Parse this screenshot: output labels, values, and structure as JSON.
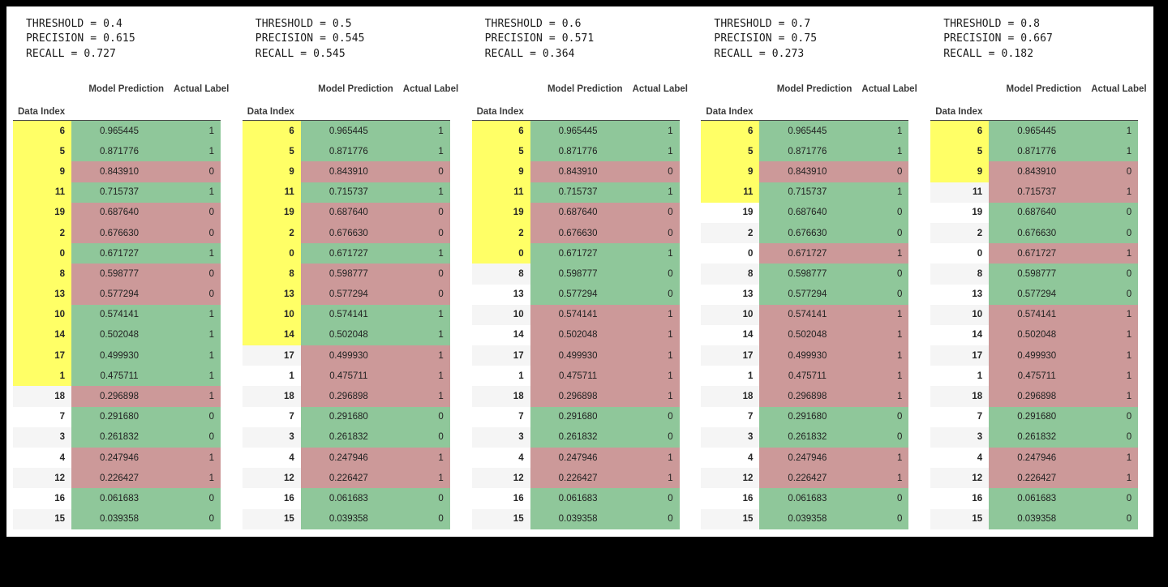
{
  "page": {
    "background_color": "#000000",
    "canvas_color": "#ffffff"
  },
  "colors": {
    "highlight_yellow": "#ffff66",
    "correct_green": "#8fc79a",
    "incorrect_red": "#cc9999",
    "row_even": "#ffffff",
    "row_odd": "#f5f5f5",
    "header_rule": "#4a4a4a",
    "text": "#222222"
  },
  "table_headers": {
    "index_name": "Data Index",
    "columns": [
      "Model Prediction",
      "Actual Label"
    ]
  },
  "rows": [
    {
      "index": "6",
      "prediction": "0.965445",
      "label": "1"
    },
    {
      "index": "5",
      "prediction": "0.871776",
      "label": "1"
    },
    {
      "index": "9",
      "prediction": "0.843910",
      "label": "0"
    },
    {
      "index": "11",
      "prediction": "0.715737",
      "label": "1"
    },
    {
      "index": "19",
      "prediction": "0.687640",
      "label": "0"
    },
    {
      "index": "2",
      "prediction": "0.676630",
      "label": "0"
    },
    {
      "index": "0",
      "prediction": "0.671727",
      "label": "1"
    },
    {
      "index": "8",
      "prediction": "0.598777",
      "label": "0"
    },
    {
      "index": "13",
      "prediction": "0.577294",
      "label": "0"
    },
    {
      "index": "10",
      "prediction": "0.574141",
      "label": "1"
    },
    {
      "index": "14",
      "prediction": "0.502048",
      "label": "1"
    },
    {
      "index": "17",
      "prediction": "0.499930",
      "label": "1"
    },
    {
      "index": "1",
      "prediction": "0.475711",
      "label": "1"
    },
    {
      "index": "18",
      "prediction": "0.296898",
      "label": "1"
    },
    {
      "index": "7",
      "prediction": "0.291680",
      "label": "0"
    },
    {
      "index": "3",
      "prediction": "0.261832",
      "label": "0"
    },
    {
      "index": "4",
      "prediction": "0.247946",
      "label": "1"
    },
    {
      "index": "12",
      "prediction": "0.226427",
      "label": "1"
    },
    {
      "index": "16",
      "prediction": "0.061683",
      "label": "0"
    },
    {
      "index": "15",
      "prediction": "0.039358",
      "label": "0"
    }
  ],
  "panels": [
    {
      "metrics": {
        "threshold_line": "THRESHOLD = 0.4",
        "precision_line": "PRECISION = 0.615",
        "recall_line": "RECALL = 0.727",
        "threshold": 0.4,
        "precision": 0.615,
        "recall": 0.727
      },
      "highlighted_count": 13,
      "has_scrollbar": false
    },
    {
      "metrics": {
        "threshold_line": "THRESHOLD = 0.5",
        "precision_line": "PRECISION = 0.545",
        "recall_line": "RECALL = 0.545",
        "threshold": 0.5,
        "precision": 0.545,
        "recall": 0.545
      },
      "highlighted_count": 11,
      "has_scrollbar": true
    },
    {
      "metrics": {
        "threshold_line": "THRESHOLD = 0.6",
        "precision_line": "PRECISION = 0.571",
        "recall_line": "RECALL = 0.364",
        "threshold": 0.6,
        "precision": 0.571,
        "recall": 0.364
      },
      "highlighted_count": 7,
      "has_scrollbar": false
    },
    {
      "metrics": {
        "threshold_line": "THRESHOLD = 0.7",
        "precision_line": "PRECISION = 0.75",
        "recall_line": "RECALL = 0.273",
        "threshold": 0.7,
        "precision": 0.75,
        "recall": 0.273
      },
      "highlighted_count": 4,
      "has_scrollbar": false
    },
    {
      "metrics": {
        "threshold_line": "THRESHOLD = 0.8",
        "precision_line": "PRECISION = 0.667",
        "recall_line": "RECALL = 0.182",
        "threshold": 0.8,
        "precision": 0.667,
        "recall": 0.182
      },
      "highlighted_count": 3,
      "has_scrollbar": false
    }
  ]
}
